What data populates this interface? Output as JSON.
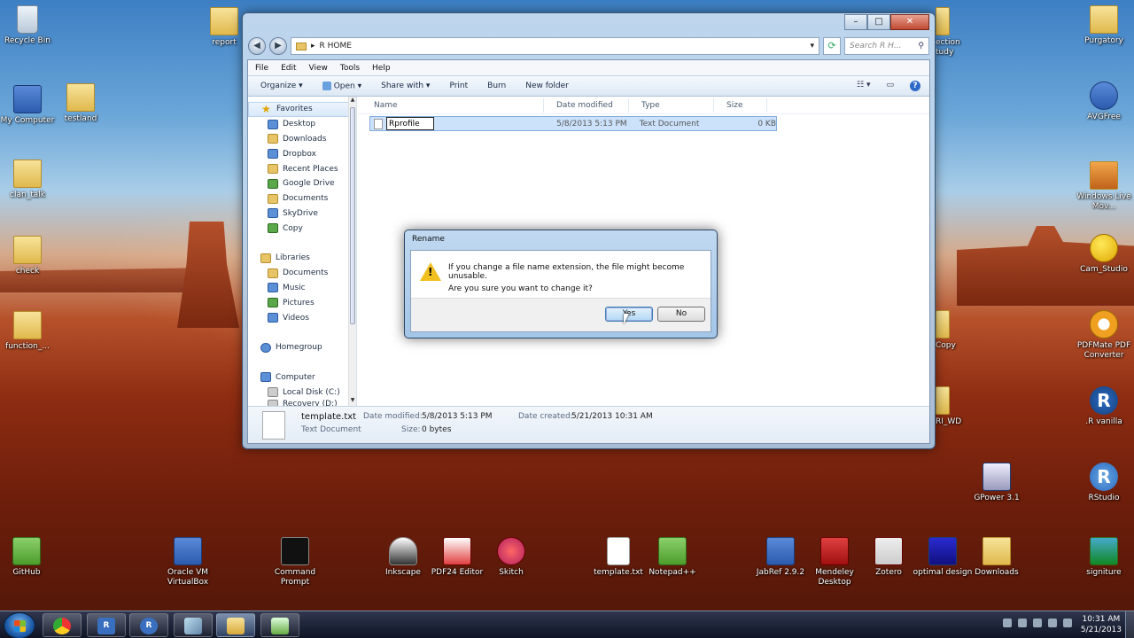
{
  "desktop": {
    "icons_left": [
      {
        "label": "Recycle Bin"
      },
      {
        "label": "My Computer"
      },
      {
        "label": "testland"
      },
      {
        "label": "clan_talk"
      },
      {
        "label": "check"
      },
      {
        "label": "function_..."
      }
    ],
    "icons_top": [
      {
        "label": "report"
      }
    ],
    "icons_right": [
      {
        "label": "Purgatory"
      },
      {
        "label": "AVGFree"
      },
      {
        "label": "Windows Live Mov..."
      },
      {
        "label": "Cam_Studio"
      },
      {
        "label": "PDFMate PDF Converter"
      },
      {
        "label": ".R vanilla"
      },
      {
        "label": "GPower 3.1"
      },
      {
        "label": "RStudio"
      },
      {
        "label": "ection tudy"
      },
      {
        "label": "Copy"
      },
      {
        "label": "RI_WD"
      }
    ],
    "icons_bottom": [
      {
        "label": "GitHub"
      },
      {
        "label": "Oracle VM VirtualBox"
      },
      {
        "label": "Command Prompt"
      },
      {
        "label": "Inkscape"
      },
      {
        "label": "PDF24 Editor"
      },
      {
        "label": "Skitch"
      },
      {
        "label": "template.txt"
      },
      {
        "label": "Notepad++"
      },
      {
        "label": "JabRef 2.9.2"
      },
      {
        "label": "Mendeley Desktop"
      },
      {
        "label": "Zotero"
      },
      {
        "label": "optimal design"
      },
      {
        "label": "Downloads"
      },
      {
        "label": "signiture"
      }
    ]
  },
  "explorer": {
    "address": "R HOME",
    "search_placeholder": "Search R H...",
    "caption": {
      "minimize": "–",
      "maximize": "□",
      "close": "✕"
    },
    "menu": [
      "File",
      "Edit",
      "View",
      "Tools",
      "Help"
    ],
    "toolbar": {
      "organize": "Organize ▾",
      "open": "Open ▾",
      "share": "Share with ▾",
      "print": "Print",
      "burn": "Burn",
      "new_folder": "New folder"
    },
    "nav": {
      "favorites": "Favorites",
      "fav_items": [
        "Desktop",
        "Downloads",
        "Dropbox",
        "Recent Places",
        "Google Drive",
        "Documents",
        "SkyDrive",
        "Copy"
      ],
      "libraries": "Libraries",
      "lib_items": [
        "Documents",
        "Music",
        "Pictures",
        "Videos"
      ],
      "homegroup": "Homegroup",
      "computer": "Computer",
      "comp_items": [
        "Local Disk (C:)",
        "Recovery (D:)"
      ]
    },
    "columns": {
      "name": "Name",
      "date": "Date modified",
      "type": "Type",
      "size": "Size"
    },
    "file": {
      "rename_value": "Rprofile",
      "date": "5/8/2013 5:13 PM",
      "type": "Text Document",
      "size": "0 KB"
    },
    "details": {
      "filename": "template.txt",
      "kind": "Text Document",
      "date_modified_label": "Date modified:",
      "date_modified": "5/8/2013 5:13 PM",
      "size_label": "Size:",
      "size": "0 bytes",
      "date_created_label": "Date created:",
      "date_created": "5/21/2013 10:31 AM"
    }
  },
  "dialog": {
    "title": "Rename",
    "message": "If you change a file name extension, the file might become unusable.",
    "question": "Are you sure you want to change it?",
    "yes": "Yes",
    "no": "No"
  },
  "taskbar": {
    "time": "10:31 AM",
    "date": "5/21/2013"
  },
  "colors": {
    "accent": "#3c7fb1",
    "selection": "#cce2fb"
  }
}
